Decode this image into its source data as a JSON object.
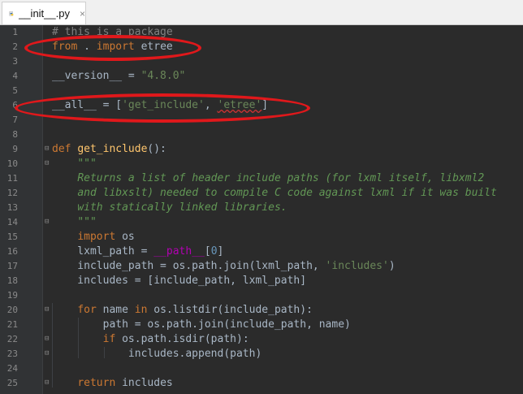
{
  "tab": {
    "label": "__init__.py",
    "close": "×"
  },
  "lines": [
    {
      "n": "1",
      "code": "<span class='com'># this is a package</span>"
    },
    {
      "n": "2",
      "code": "<span class='kw'>from</span> . <span class='kw'>import</span> etree"
    },
    {
      "n": "3",
      "code": ""
    },
    {
      "n": "4",
      "code": "__version__ = <span class='str'>\"4.8.0\"</span>"
    },
    {
      "n": "5",
      "code": ""
    },
    {
      "n": "6",
      "code": "__all__ = [<span class='str'>'get_include'</span>, <span class='str squiggle'>'etree'</span>]"
    },
    {
      "n": "7",
      "code": ""
    },
    {
      "n": "8",
      "code": ""
    },
    {
      "n": "9",
      "code": "<span class='kw'>def</span> <span class='fn'>get_include</span>():"
    },
    {
      "n": "10",
      "code": "    <span class='doc'>\"\"\"</span>"
    },
    {
      "n": "11",
      "code": "    <span class='doc'>Returns a list of header include paths (for lxml itself, libxml2</span>"
    },
    {
      "n": "12",
      "code": "    <span class='doc'>and libxslt) needed to compile C code against lxml if it was built</span>"
    },
    {
      "n": "13",
      "code": "    <span class='doc'>with statically linked libraries.</span>"
    },
    {
      "n": "14",
      "code": "    <span class='doc'>\"\"\"</span>"
    },
    {
      "n": "15",
      "code": "    <span class='kw'>import</span> os"
    },
    {
      "n": "16",
      "code": "    lxml_path = <span class='dunder'>__path__</span>[<span class='num-lit'>0</span>]"
    },
    {
      "n": "17",
      "code": "    include_path = os.path.join(lxml_path, <span class='str'>'includes'</span>)"
    },
    {
      "n": "18",
      "code": "    includes = [include_path, lxml_path]"
    },
    {
      "n": "19",
      "code": ""
    },
    {
      "n": "20",
      "code": "    <span class='kw'>for</span> name <span class='kw'>in</span> os.listdir(include_path):"
    },
    {
      "n": "21",
      "code": "        path = os.path.join(include_path, name)"
    },
    {
      "n": "22",
      "code": "        <span class='kw'>if</span> os.path.isdir(path):"
    },
    {
      "n": "23",
      "code": "            includes.append(path)"
    },
    {
      "n": "24",
      "code": ""
    },
    {
      "n": "25",
      "code": "    <span class='kw'>return</span> includes"
    }
  ],
  "folds": {
    "9": "⊟",
    "10": "⊟",
    "14": "⊟",
    "20": "⊟",
    "22": "⊟",
    "23": "⊟",
    "25": "⊟"
  }
}
